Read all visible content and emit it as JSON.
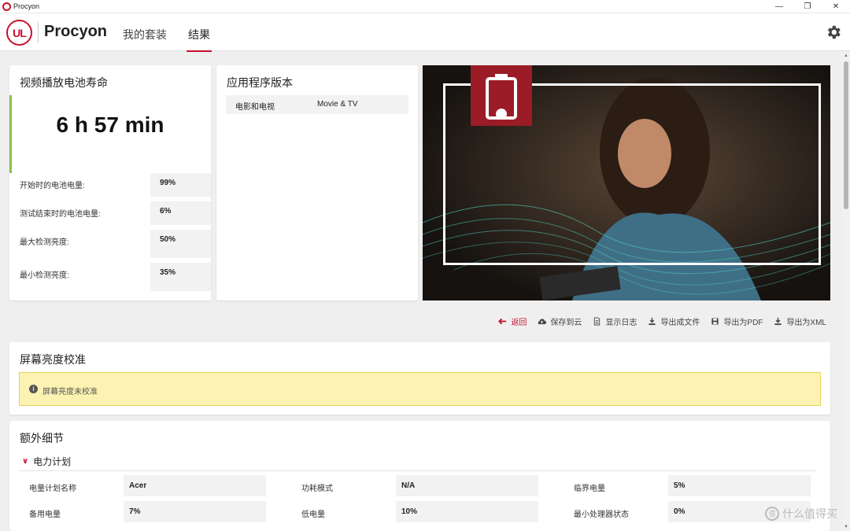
{
  "titlebar": {
    "app_name": "Procyon",
    "minimize": "—",
    "maximize": "❐",
    "close": "✕"
  },
  "header": {
    "brand": "Procyon",
    "logo_text": "UL",
    "nav": {
      "suites": "我的套装",
      "results": "结果"
    }
  },
  "battery_card": {
    "title": "视频播放电池寿命",
    "value": "6 h 57 min",
    "stats": [
      {
        "label": "开始时的电池电量:",
        "value": "99%"
      },
      {
        "label": "测试结束时的电池电量:",
        "value": "6%"
      },
      {
        "label": "最大检测亮度:",
        "value": "50%"
      },
      {
        "label": "最小检测亮度:",
        "value": "35%"
      }
    ],
    "accent_color": "#8bc34a"
  },
  "app_card": {
    "title": "应用程序版本",
    "row": {
      "name": "电影和电视",
      "value": "Movie & TV"
    }
  },
  "toolbar": {
    "back": "返回",
    "save_cloud": "保存到云",
    "show_log": "显示日志",
    "export_file": "导出成文件",
    "export_pdf": "导出为PDF",
    "export_xml": "导出为XML"
  },
  "calibration": {
    "title": "屏幕亮度校准",
    "warning": "屏幕亮度未校准"
  },
  "extra": {
    "title": "额外细节",
    "section": "电力计划",
    "rows": [
      [
        {
          "label": "电量计划名称",
          "value": "Acer"
        },
        {
          "label": "功耗模式",
          "value": "N/A"
        },
        {
          "label": "临界电量",
          "value": "5%"
        }
      ],
      [
        {
          "label": "备用电量",
          "value": "7%"
        },
        {
          "label": "低电量",
          "value": "10%"
        },
        {
          "label": "最小处理器状态",
          "value": "0%"
        }
      ]
    ]
  },
  "watermark": {
    "text": "什么值得买",
    "icon_text": "值"
  },
  "colors": {
    "brand_red": "#c8102e",
    "warning_bg": "#fcf2b1",
    "hero_badge": "#9b1b26"
  }
}
